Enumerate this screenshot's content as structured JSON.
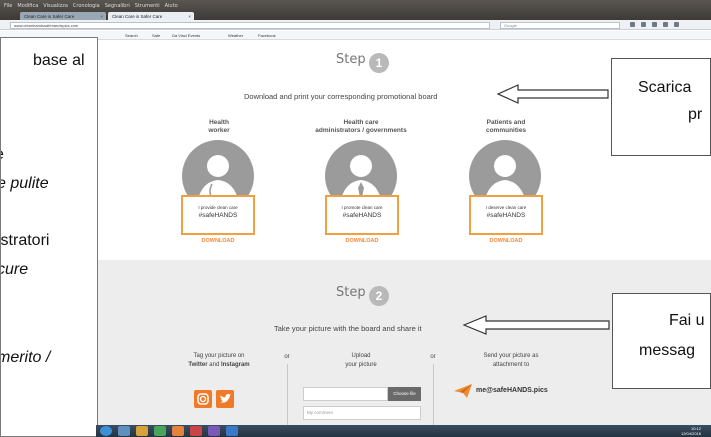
{
  "browser": {
    "menu": [
      "File",
      "Modifica",
      "Visualizza",
      "Cronologia",
      "Segnalibri",
      "Strumenti",
      "Aiuto"
    ],
    "tabs": [
      {
        "label": "Clean Care is Safer Care"
      },
      {
        "label": "Clean Care is Safer Care"
      }
    ],
    "url": "www.cleanhandssafehandspics.com",
    "search_placeholder": "Google"
  },
  "bookmarks": [
    "Search",
    "Safe",
    "Da Vinci Events",
    "Weather",
    "Facebook"
  ],
  "site": {
    "step1": {
      "label": "Step",
      "number": "1",
      "instruction": "Download and print your corresponding promotional board",
      "columns": [
        {
          "heading_1": "Health",
          "heading_2": "worker",
          "board_line1": "I provide clean care",
          "board_line2": "#safeHANDS",
          "download": "DOWNLOAD"
        },
        {
          "heading_1": "Health care",
          "heading_2": "administrators / governments",
          "board_line1": "I promote clean care",
          "board_line2": "#safeHANDS",
          "download": "DOWNLOAD"
        },
        {
          "heading_1": "Patients and",
          "heading_2": "communities",
          "board_line1": "I deserve clean care",
          "board_line2": "#safeHANDS",
          "download": "DOWNLOAD"
        }
      ]
    },
    "step2": {
      "label": "Step",
      "number": "2",
      "instruction": "Take your picture with the board and share it",
      "col1": {
        "line1": "Tag your picture on",
        "twitter": "Twitter",
        "and": "and",
        "instagram": "Instagram"
      },
      "col2": {
        "line1": "Upload",
        "line2": "your picture",
        "choose": "Choose file",
        "comment_placeholder": "My comment"
      },
      "col3": {
        "line1": "Send your picture as",
        "line2": "attachment to",
        "email": "me@safeHANDS.pics"
      },
      "separators": [
        "or",
        "or"
      ]
    }
  },
  "left_panel": {
    "lines": [
      "base al",
      "e",
      "e pulite",
      "istratori",
      "cure",
      "merito /",
      "-"
    ]
  },
  "callouts": {
    "top": {
      "line1": "Scarica",
      "line2": "pr"
    },
    "bottom": {
      "line1": "Fai u",
      "line2": "messag"
    }
  },
  "taskbar": {
    "time": "10:12",
    "date": "12/04/2016"
  },
  "colors": {
    "accent_orange": "#f08a30",
    "circle_gray": "#9b9b9b",
    "step2_bg": "#ededed"
  }
}
